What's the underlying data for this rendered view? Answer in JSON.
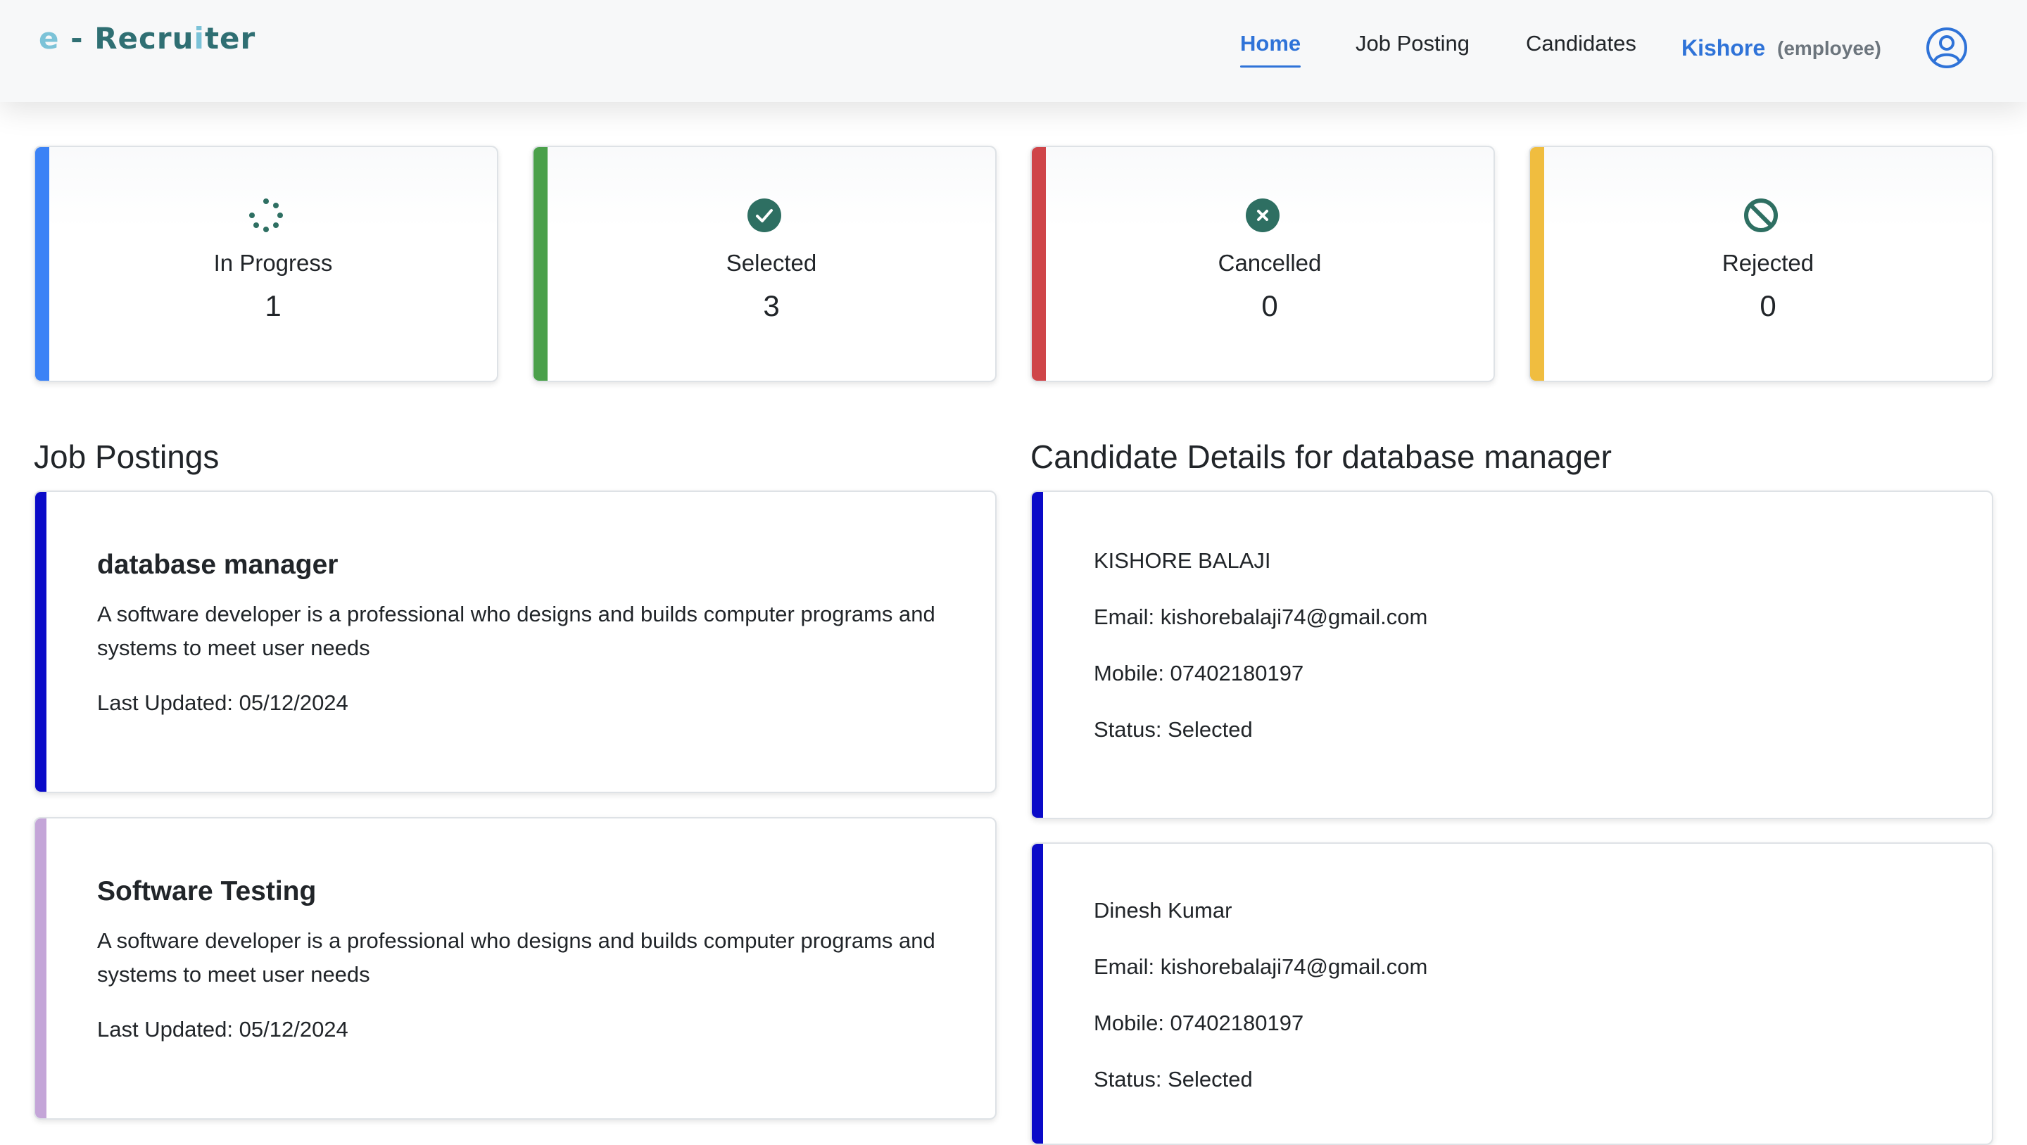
{
  "brand": {
    "prefix": "e",
    "dash": " - ",
    "name_a": "Recru",
    "name_i": "i",
    "name_b": "ter"
  },
  "nav": {
    "links": [
      {
        "label": "Home",
        "active": true
      },
      {
        "label": "Job Posting",
        "active": false
      },
      {
        "label": "Candidates",
        "active": false
      }
    ],
    "user_name": "Kishore",
    "user_role": "(employee)",
    "avatar_icon": "user-circle-icon"
  },
  "stats": [
    {
      "label": "In Progress",
      "value": "1",
      "icon": "spinner-icon",
      "color": "#3b82f6"
    },
    {
      "label": "Selected",
      "value": "3",
      "icon": "check-circle-icon",
      "color": "#4aa04a"
    },
    {
      "label": "Cancelled",
      "value": "0",
      "icon": "x-circle-icon",
      "color": "#cf4549"
    },
    {
      "label": "Rejected",
      "value": "0",
      "icon": "ban-icon",
      "color": "#f0bd3f"
    }
  ],
  "icon_color": "#2e6f62",
  "job_postings": {
    "title": "Job Postings",
    "items": [
      {
        "title": "database manager",
        "description": "A software developer is a professional who designs and builds computer programs and systems to meet user needs",
        "updated": "Last Updated: 05/12/2024",
        "color": "#0a0ac8"
      },
      {
        "title": "Software Testing",
        "description": "A software developer is a professional who designs and builds computer programs and systems to meet user needs",
        "updated": "Last Updated: 05/12/2024",
        "color": "#c4a5d8"
      }
    ]
  },
  "candidates": {
    "title": "Candidate Details for database manager",
    "items": [
      {
        "name": "KISHORE BALAJI",
        "email": "Email: kishorebalaji74@gmail.com",
        "mobile": "Mobile: 07402180197",
        "status": "Status: Selected",
        "color": "#0a0ac8"
      },
      {
        "name": "Dinesh Kumar",
        "email": "Email: kishorebalaji74@gmail.com",
        "mobile": "Mobile: 07402180197",
        "status": "Status: Selected",
        "color": "#0a0ac8"
      }
    ]
  }
}
